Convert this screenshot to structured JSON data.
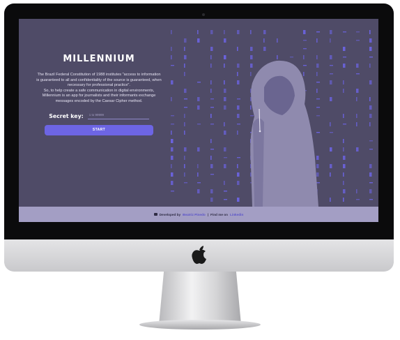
{
  "app": {
    "title": "MILLENNIUM",
    "description_lines": [
      "The Brazil Federal Constitution of 1988 institutes \"access to information is guaranteed to all and confidentiality of the source is guaranteed, when necessary for professional practice\".",
      "So, to help create a safe communication in digital environments, Millennium is an app for journalists and their informants exchange messages encoded by the Caesar Cipher method."
    ],
    "secret_key_label": "Secret key:",
    "secret_key_placeholder": "1 to 99999",
    "secret_key_value": "",
    "start_button_label": "START"
  },
  "footer": {
    "developed_by_label": "Developed by",
    "developer_name": "Beatriz Pinedo",
    "separator": "|",
    "find_me_label": "Find me on",
    "linkedin_label": "Linkedin"
  },
  "colors": {
    "screen_background": "#4f4b67",
    "accent": "#6d65e4",
    "matrix_glyph": "#6b63e0",
    "hoodie": "#8f8aae",
    "footer_background": "#a39ec4"
  },
  "icons": [
    "apple-logo-icon",
    "book-icon"
  ]
}
